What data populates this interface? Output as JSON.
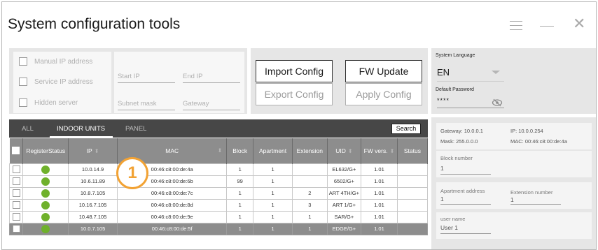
{
  "window": {
    "title": "System configuration tools"
  },
  "options": {
    "manual_ip": "Manual IP address",
    "service_ip": "Service IP address",
    "hidden_server": "Hidden server"
  },
  "ip_fields": {
    "start_ip": "Start IP",
    "end_ip": "End IP",
    "subnet_mask": "Subnet mask",
    "gateway": "Gateway"
  },
  "buttons": {
    "import_config": "Import Config",
    "fw_update": "FW Update",
    "export_config": "Export Config",
    "apply_config": "Apply Config"
  },
  "settings": {
    "language_label": "System Language",
    "language_value": "EN",
    "password_label": "Default Password",
    "password_value": "****"
  },
  "tabs": {
    "all": "ALL",
    "indoor_units": "INDOOR UNITS",
    "panel": "PANEL",
    "search": "Search"
  },
  "table": {
    "headers": [
      "RegisterStatus",
      "IP",
      "MAC",
      "Block",
      "Apartment",
      "Extension",
      "UID",
      "FW vers.",
      "Status"
    ],
    "rows": [
      [
        "",
        "10.0.14.9",
        "00:46:c8:00:de:4a",
        "1",
        "1",
        "",
        "EL632/G+",
        "1.01",
        ""
      ],
      [
        "",
        "10.6.11.89",
        "00:46:c8:00:de:6b",
        "99",
        "1",
        "",
        "6502/G+",
        "1.01",
        ""
      ],
      [
        "",
        "10.8.7.105",
        "00:46:c8:00:de:7c",
        "1",
        "1",
        "2",
        "ART 4TH/G+",
        "1.01",
        ""
      ],
      [
        "",
        "10.16.7.105",
        "00:46:c8:00:de:8d",
        "1",
        "1",
        "3",
        "ART 1/G+",
        "1.01",
        ""
      ],
      [
        "",
        "10.48.7.105",
        "00:46:c8:00:de:9e",
        "1",
        "1",
        "1",
        "SAR/G+",
        "1.01",
        ""
      ],
      [
        "",
        "10.0.7.105",
        "00:46:c8:00:de:5f",
        "1",
        "1",
        "1",
        "EDGE/G+",
        "1.01",
        ""
      ]
    ]
  },
  "callout": "1",
  "details": {
    "gateway": "Gateway:  10.0.0.1",
    "ip": "IP:  10.0.0.254",
    "mask": "Mask:  255.0.0.0",
    "mac": "MAC:  00:46:c8:00:de:4a",
    "block_label": "Block number",
    "block_value": "1",
    "apartment_label": "Apartment address",
    "apartment_value": "1",
    "extension_label": "Extension number",
    "extension_value": "1",
    "user_label": "user name",
    "user_value": "User 1"
  },
  "colors": {
    "status_ok": "#6fb12b",
    "callout": "#f2a233",
    "header": "#8d8d8d",
    "tabbar": "#474747"
  }
}
